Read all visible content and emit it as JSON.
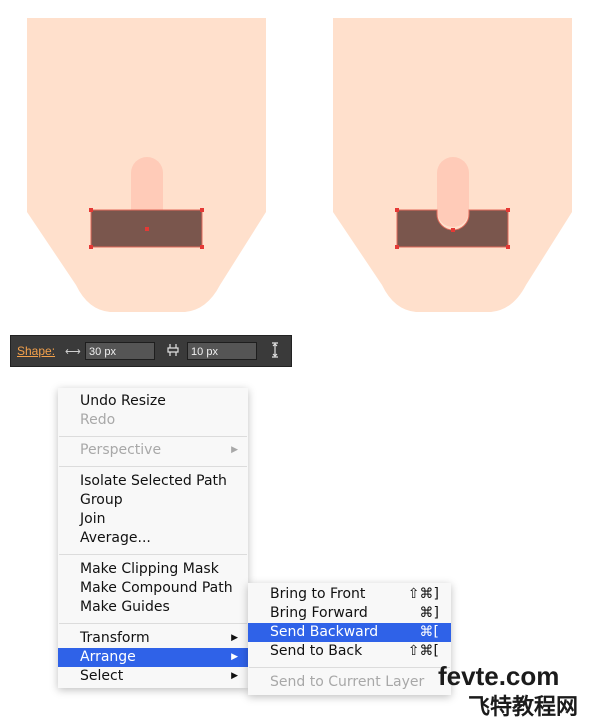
{
  "toolbar": {
    "shape_label": "Shape:",
    "width_value": "30 px",
    "height_value": "10 px"
  },
  "context_menu": {
    "items": {
      "undo": "Undo Resize",
      "redo": "Redo",
      "perspective": "Perspective",
      "isolate": "Isolate Selected Path",
      "group": "Group",
      "join": "Join",
      "average": "Average...",
      "clipping_mask": "Make Clipping Mask",
      "compound_path": "Make Compound Path",
      "guides": "Make Guides",
      "transform": "Transform",
      "arrange": "Arrange",
      "select": "Select"
    }
  },
  "arrange_submenu": {
    "items": {
      "bring_front": "Bring to Front",
      "bring_front_shortcut": "⇧⌘]",
      "bring_forward": "Bring Forward",
      "bring_forward_shortcut": "⌘]",
      "send_backward": "Send Backward",
      "send_backward_shortcut": "⌘[",
      "send_back": "Send to Back",
      "send_back_shortcut": "⇧⌘[",
      "send_current_layer": "Send to Current Layer"
    }
  },
  "watermark": {
    "line1": "fevte.com",
    "line2": "飞特教程网"
  },
  "colors": {
    "skin": "#ffe0cc",
    "finger": "#ffcbb8",
    "rect": "#7a564d",
    "anchor": "#e53935",
    "menu_highlight": "#2f62e8"
  }
}
